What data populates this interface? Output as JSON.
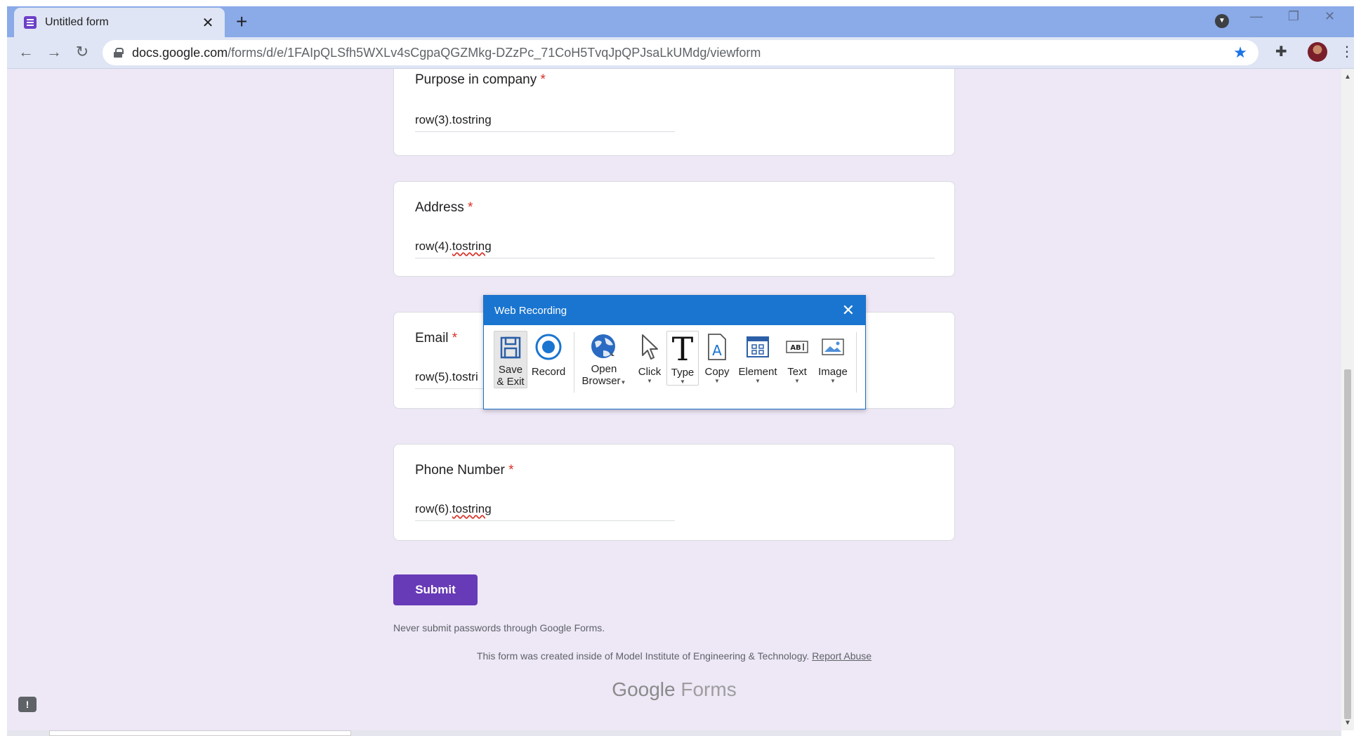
{
  "browser": {
    "tab_title": "Untitled form",
    "tab_close": "✕",
    "new_tab": "+",
    "url_domain": "docs.google.com",
    "url_path": "/forms/d/e/1FAIpQLSfh5WXLv4sCgpaQGZMkg-DZzPc_71CoH5TvqJpQPJsaLkUMdg/viewform"
  },
  "form": {
    "required_mark": "*",
    "questions": [
      {
        "title": "Purpose in company",
        "answer_prefix": "row(3).",
        "answer_word": "tostring"
      },
      {
        "title": "Address",
        "answer_prefix": "row(4).",
        "answer_word": "tostring"
      },
      {
        "title": "Email",
        "answer_prefix": "row(5).",
        "answer_word": "tostri"
      },
      {
        "title": "Phone Number",
        "answer_prefix": "row(6).",
        "answer_word": "tostring"
      }
    ],
    "submit_label": "Submit",
    "never_submit": "Never submit passwords through Google Forms.",
    "created_text": "This form was created inside of Model Institute of Engineering & Technology.",
    "report_abuse": "Report Abuse",
    "brand_google": "Google",
    "brand_forms": "Forms"
  },
  "recorder": {
    "title": "Web Recording",
    "close": "✕",
    "tools": {
      "save_line1": "Save",
      "save_line2": "& Exit",
      "record": "Record",
      "open_line1": "Open",
      "open_line2": "Browser",
      "click": "Click",
      "type": "Type",
      "copy": "Copy",
      "element": "Element",
      "text": "Text",
      "image": "Image"
    },
    "accent": "#1a75d0"
  },
  "colors": {
    "form_purple": "#673ab7",
    "page_bg": "#ede7f6",
    "required_red": "#d93025"
  }
}
